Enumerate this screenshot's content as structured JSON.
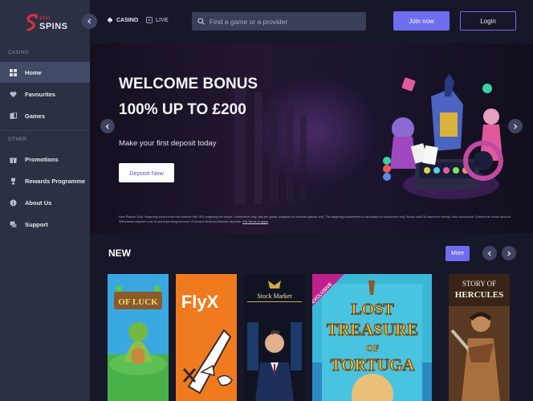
{
  "brand": {
    "small": "21st",
    "name": "SPINS"
  },
  "sidebar": {
    "casino_label": "CASINO",
    "other_label": "OTHER",
    "items": [
      {
        "label": "Home",
        "icon": "grid-icon",
        "active": true
      },
      {
        "label": "Favourites",
        "icon": "heart-icon"
      },
      {
        "label": "Games",
        "icon": "cards-icon"
      },
      {
        "label": "Promotions",
        "icon": "gift-icon"
      },
      {
        "label": "Rewards Programme",
        "icon": "trophy-icon"
      },
      {
        "label": "About Us",
        "icon": "info-icon"
      },
      {
        "label": "Support",
        "icon": "chat-icon"
      }
    ]
  },
  "header": {
    "tabs": [
      {
        "label": "CASINO",
        "icon": "spade-icon"
      },
      {
        "label": "LIVE",
        "icon": "live-icon"
      }
    ],
    "search_placeholder": "Find a game or a provider",
    "join_label": "Join now",
    "login_label": "Login"
  },
  "hero": {
    "title_line1": "WELCOME BONUS",
    "title_line2": "100% UP TO £200",
    "subtitle": "Make your first deposit today",
    "button_label": "Deposit Now",
    "terms": "New Players Only. Wagering occurs from real balance first. 50X wagering the bonus. Contribution may vary per game. Available on selected games only. The wagering requirement is calculated on bonus bets only. Bonus valid 30 days from receipt. Max conversion: 3 times the bonus amount. Withdrawal requests void all active/pending bonuses. Excluded Skrill and Neteller deposits.",
    "terms_link": "Full Terms to apply"
  },
  "new_section": {
    "title": "NEW",
    "more_label": "More",
    "games": [
      {
        "title_line1": "OF LUCK",
        "badge": ""
      },
      {
        "title_line1": "FlyX",
        "badge": ""
      },
      {
        "title_line1": "Stock Market",
        "badge": ""
      },
      {
        "title_line1": "LOST",
        "title_line2": "TREASURE",
        "title_line3": "OF",
        "title_line4": "TORTUGA",
        "badge": "EXCLUSIVE"
      },
      {
        "title_line1": "STORY OF",
        "title_line2": "HERCULES",
        "badge": ""
      }
    ]
  },
  "colors": {
    "accent": "#6e6df0",
    "sidebar": "#2b3045",
    "background": "#16182a",
    "brand_red": "#d8303c"
  }
}
